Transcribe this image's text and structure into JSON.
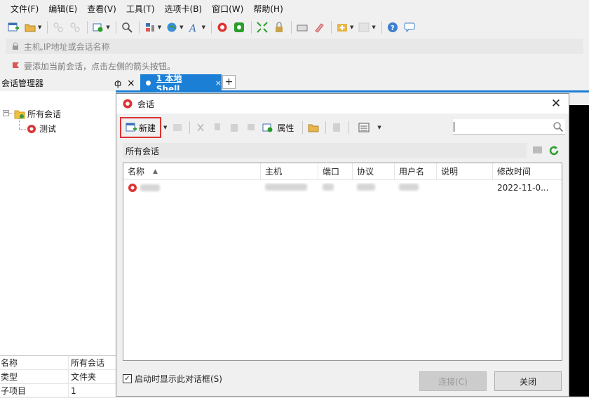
{
  "menu": [
    "文件(F)",
    "编辑(E)",
    "查看(V)",
    "工具(T)",
    "选项卡(B)",
    "窗口(W)",
    "帮助(H)"
  ],
  "address": {
    "placeholder": "主机,IP地址或会话名称"
  },
  "hint": "要添加当前会话，点击左侧的箭头按钮。",
  "session_manager": {
    "title": "会话管理器",
    "pin": "ф",
    "close": "×",
    "tree": {
      "root": "所有会话",
      "child": "测试"
    }
  },
  "tabs": {
    "active": "1 本地Shell",
    "plus": "+"
  },
  "props": [
    {
      "k": "名称",
      "v": "所有会话"
    },
    {
      "k": "类型",
      "v": "文件夹"
    },
    {
      "k": "子项目",
      "v": "1"
    }
  ],
  "dialog": {
    "title": "会话",
    "new_label": "新建",
    "props_label": "属性",
    "path": "所有会话",
    "columns": [
      "名称",
      "主机",
      "端口",
      "协议",
      "用户名",
      "说明",
      "修改时间"
    ],
    "row": {
      "modified": "2022-11-0..."
    },
    "startup_checkbox": "启动时显示此对话框(S)",
    "connect": "连接(C)",
    "close": "关闭"
  },
  "colors": {
    "accent": "#1c7fd6",
    "highlight_border": "#d33333"
  }
}
